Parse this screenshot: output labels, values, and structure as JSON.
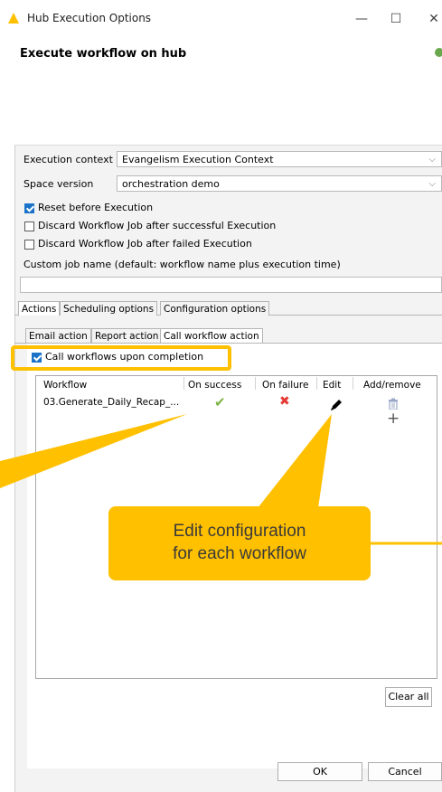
{
  "window": {
    "title": "Hub Execution Options"
  },
  "header": {
    "title": "Execute workflow on hub"
  },
  "form": {
    "execution_context_label": "Execution context",
    "execution_context_value": "Evangelism Execution Context",
    "space_version_label": "Space version",
    "space_version_value": "orchestration demo",
    "checkboxes": [
      {
        "label": "Reset before Execution",
        "checked": true
      },
      {
        "label": "Discard Workflow Job after successful Execution",
        "checked": false
      },
      {
        "label": "Discard Workflow Job after failed Execution",
        "checked": false
      }
    ],
    "custom_job_label": "Custom job name (default: workflow name plus execution time)",
    "custom_job_value": ""
  },
  "tabs_primary": [
    "Actions",
    "Scheduling options",
    "Configuration options"
  ],
  "tabs_secondary": [
    "Email action",
    "Report action",
    "Call workflow action"
  ],
  "call_workflows": {
    "label": "Call workflows upon completion",
    "checked": true
  },
  "table": {
    "columns": [
      "Workflow",
      "On success",
      "On failure",
      "Edit",
      "Add/remove"
    ],
    "rows": [
      {
        "workflow": "03.Generate_Daily_Recap_...",
        "on_success": "✔",
        "on_failure": "✖",
        "edit": "✎"
      }
    ]
  },
  "buttons": {
    "clear_all": "Clear all",
    "ok": "OK",
    "cancel": "Cancel"
  },
  "callout": {
    "line1": "Edit configuration",
    "line2": "for each workflow"
  },
  "colors": {
    "accent": "#ffc000",
    "success": "#7cb342",
    "failure": "#e53935",
    "checkbox": "#1a73c8"
  }
}
